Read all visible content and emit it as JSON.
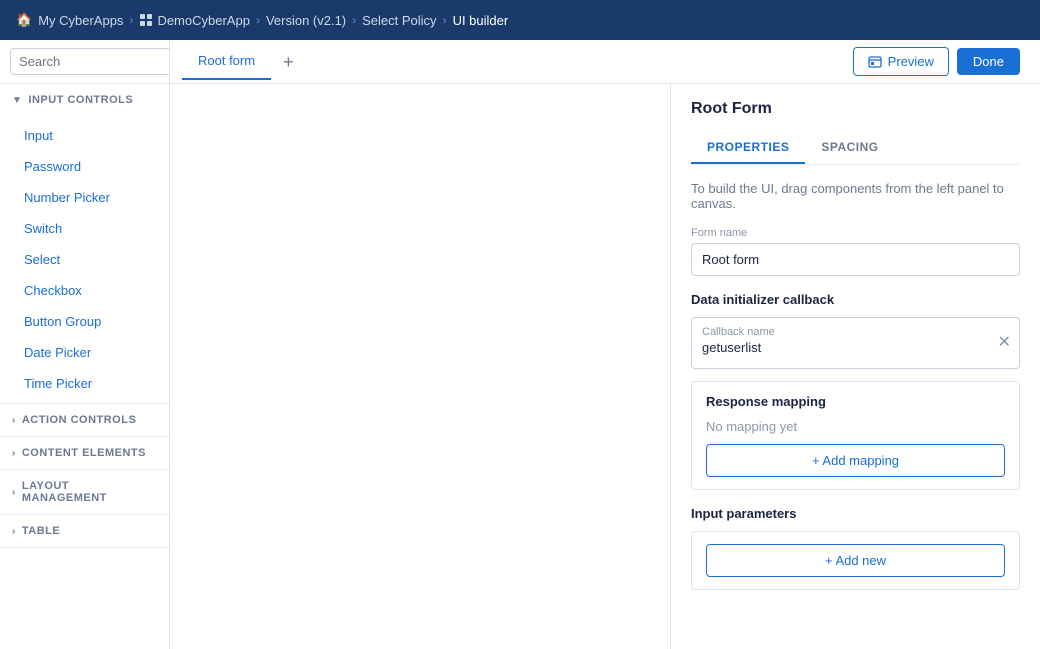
{
  "nav": {
    "home_icon": "🏠",
    "items": [
      {
        "label": "My CyberApps",
        "active": false
      },
      {
        "label": "DemoCyberApp",
        "active": false
      },
      {
        "label": "Version (v2.1)",
        "active": false
      },
      {
        "label": "Select Policy",
        "active": false
      },
      {
        "label": "UI builder",
        "active": true
      }
    ]
  },
  "search": {
    "placeholder": "Search",
    "value": ""
  },
  "sidebar": {
    "sections": [
      {
        "id": "input-controls",
        "label": "INPUT CONTROLS",
        "expanded": true,
        "items": [
          {
            "label": "Input"
          },
          {
            "label": "Password"
          },
          {
            "label": "Number Picker"
          },
          {
            "label": "Switch"
          },
          {
            "label": "Select"
          },
          {
            "label": "Checkbox"
          },
          {
            "label": "Button Group"
          },
          {
            "label": "Date Picker"
          },
          {
            "label": "Time Picker"
          }
        ]
      },
      {
        "id": "action-controls",
        "label": "ACTION CONTROLS",
        "expanded": false,
        "items": []
      },
      {
        "id": "content-elements",
        "label": "CONTENT ELEMENTS",
        "expanded": false,
        "items": []
      },
      {
        "id": "layout-management",
        "label": "LAYOUT MANAGEMENT",
        "expanded": false,
        "items": []
      },
      {
        "id": "table",
        "label": "TABLE",
        "expanded": false,
        "items": []
      }
    ]
  },
  "canvas": {
    "tab_label": "Root form",
    "add_label": "+"
  },
  "header": {
    "preview_label": "Preview",
    "done_label": "Done"
  },
  "right_panel": {
    "title": "Root Form",
    "tabs": [
      {
        "label": "PROPERTIES",
        "active": true
      },
      {
        "label": "SPACING",
        "active": false
      }
    ],
    "hint": "To build the UI, drag components from the left panel to canvas.",
    "form_name_label": "Form name",
    "form_name_value": "Root form",
    "data_initializer_label": "Data initializer callback",
    "callback_name_label": "Callback name",
    "callback_name_value": "getuserlist",
    "response_mapping_label": "Response mapping",
    "no_mapping_label": "No mapping yet",
    "add_mapping_label": "+ Add mapping",
    "input_parameters_label": "Input parameters",
    "add_new_label": "+ Add new"
  }
}
